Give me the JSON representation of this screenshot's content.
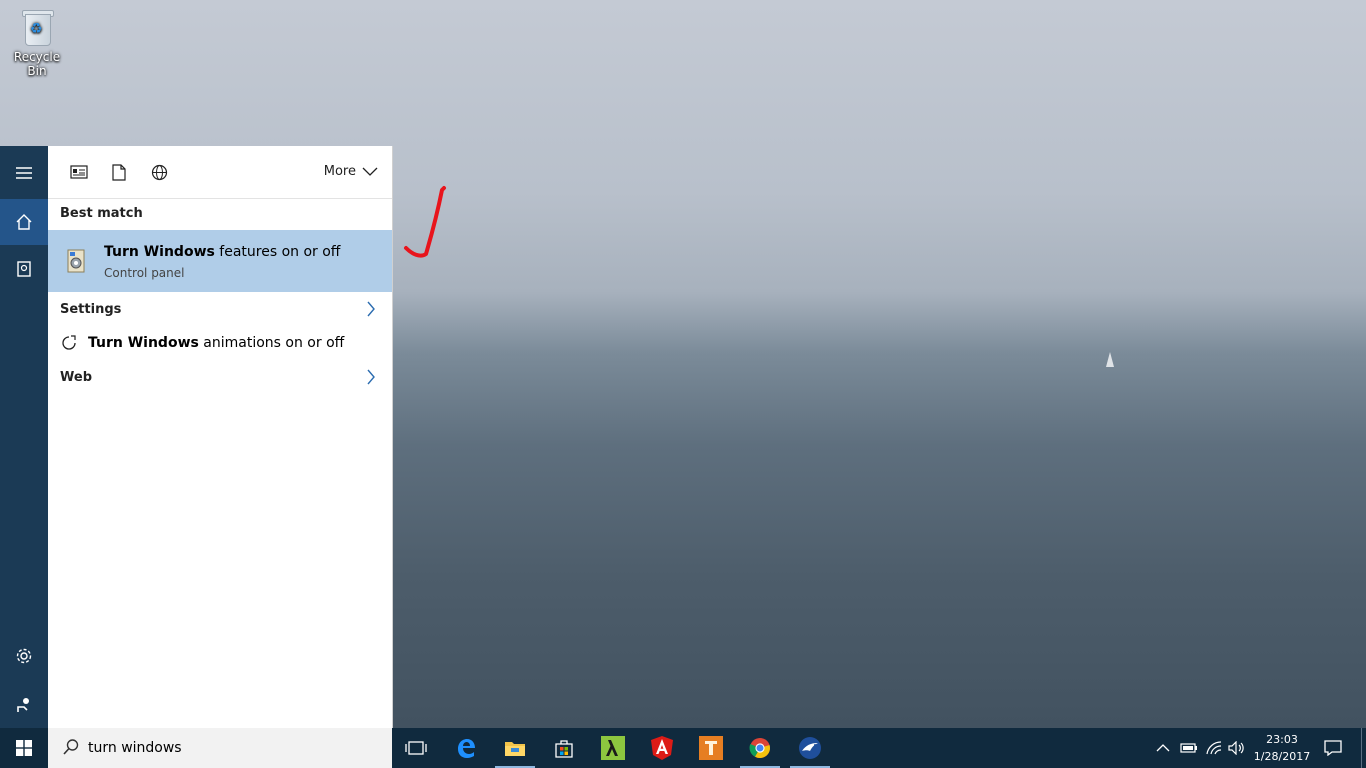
{
  "desktop": {
    "recycle_bin_label": "Recycle Bin"
  },
  "start_menu": {
    "filters_more_label": "More",
    "best_match_heading": "Best match",
    "best_match": {
      "title_bold": "Turn Windows",
      "title_rest": " features on or off",
      "subtitle": "Control panel"
    },
    "settings_heading": "Settings",
    "settings_item": {
      "title_bold": "Turn Windows",
      "title_rest": " animations on or off"
    },
    "web_heading": "Web"
  },
  "search": {
    "value": "turn windows"
  },
  "clock": {
    "time": "23:03",
    "date": "1/28/2017"
  },
  "colors": {
    "accent": "#24558a",
    "highlight": "#b0cde8",
    "annotation": "#e8141c"
  },
  "icons": [
    "hamburger-icon",
    "home-icon",
    "notebook-icon",
    "settings-gear-icon",
    "feedback-icon",
    "apps-filter-icon",
    "documents-filter-icon",
    "web-filter-icon",
    "chevron-down-icon",
    "chevron-right-icon",
    "windows-features-icon",
    "animation-icon",
    "search-icon",
    "windows-logo-icon",
    "task-view-icon",
    "edge-icon",
    "file-explorer-icon",
    "store-icon",
    "lambda-app-icon",
    "angular-icon",
    "app-orange-icon",
    "chrome-icon",
    "bird-app-icon",
    "show-hidden-icons-chevron-icon",
    "battery-icon",
    "wifi-icon",
    "volume-icon",
    "action-center-icon"
  ]
}
